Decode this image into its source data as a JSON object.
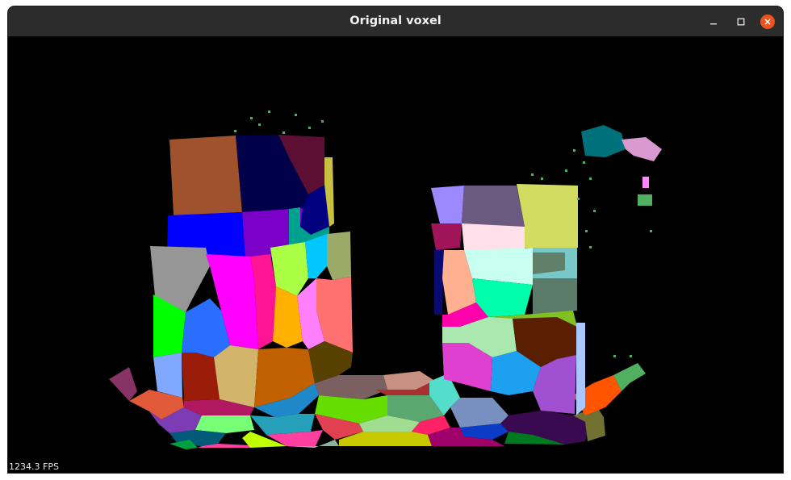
{
  "window": {
    "title": "Original voxel",
    "controls": {
      "minimize_icon": "minimize-icon",
      "maximize_icon": "maximize-icon",
      "close_icon": "close-icon",
      "close_color": "#e95420"
    }
  },
  "viewport": {
    "background": "#000000",
    "fps_text": "1234.3 FPS"
  }
}
